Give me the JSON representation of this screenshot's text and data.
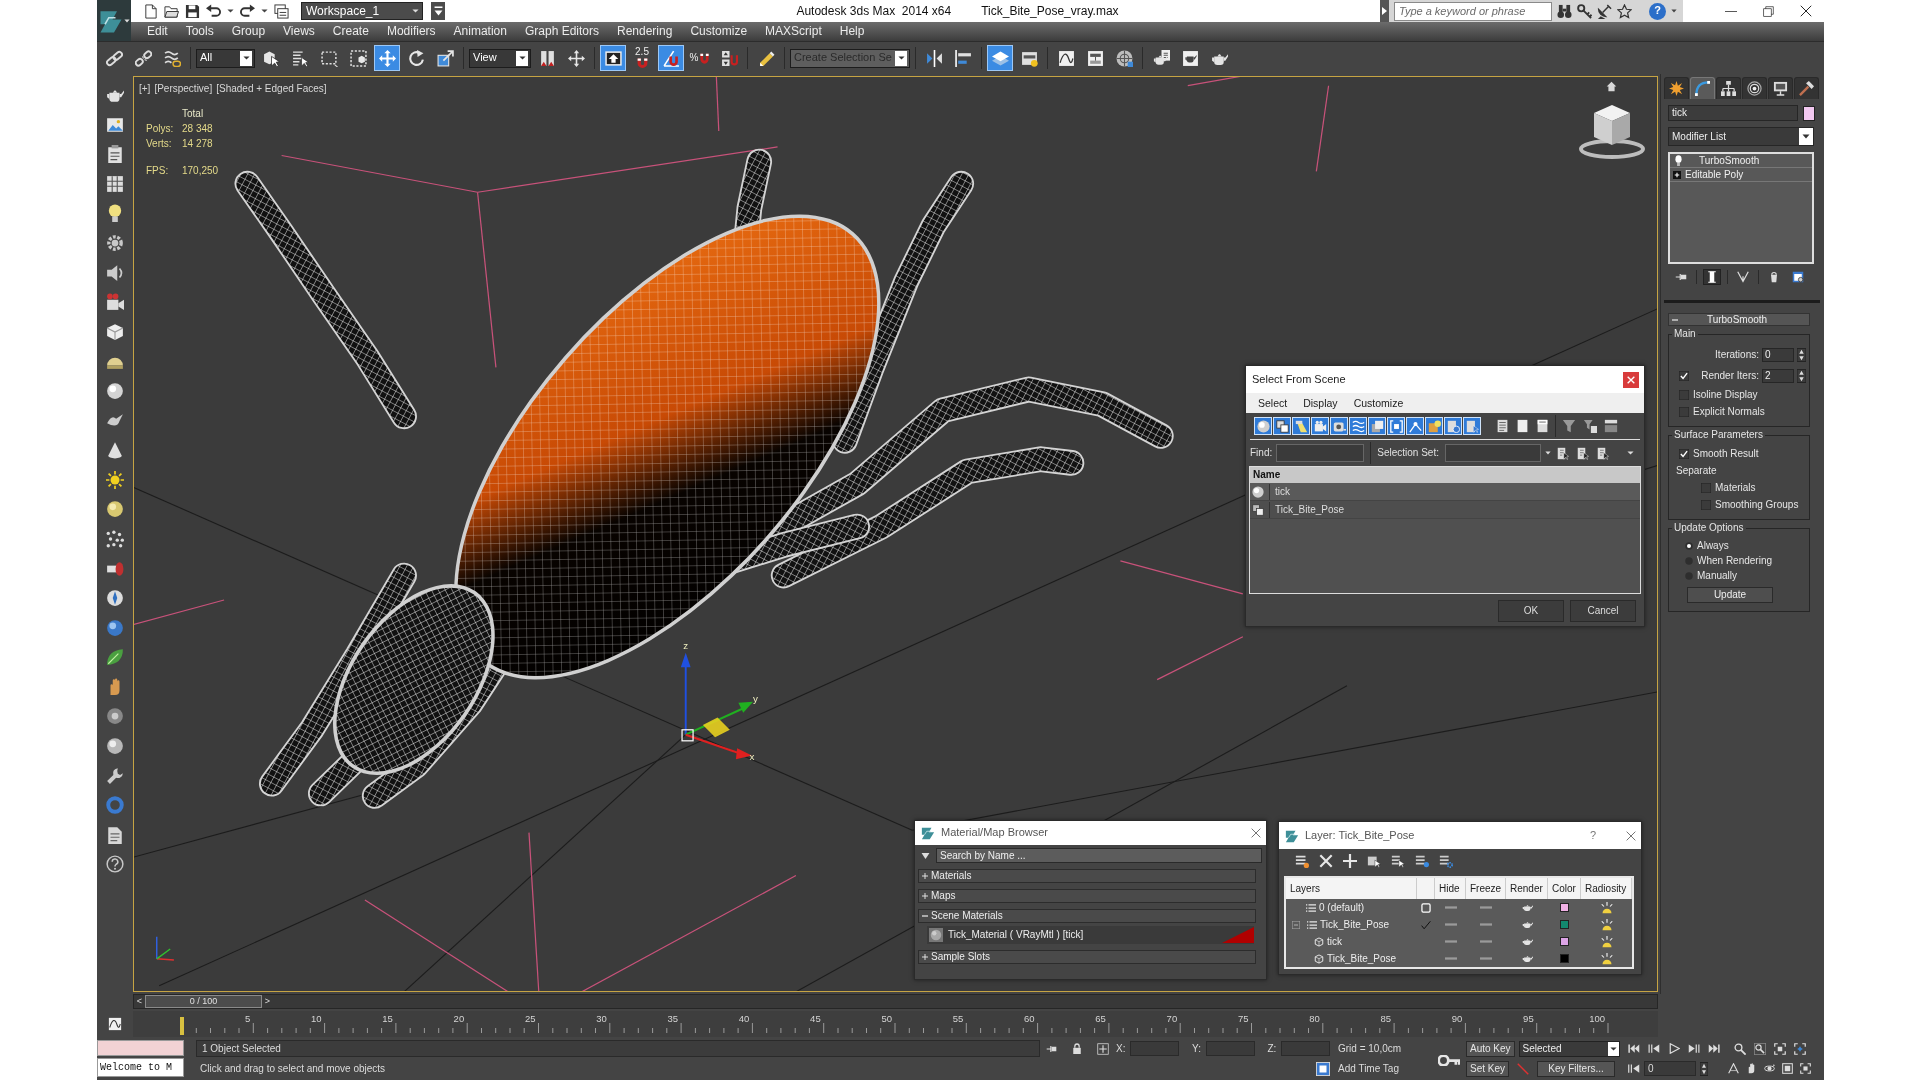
{
  "title_bar": {
    "workspace": "Workspace_1",
    "app": "Autodesk 3ds Max  2014 x64",
    "file": "Tick_Bite_Pose_vray.max",
    "search_placeholder": "Type a keyword or phrase",
    "help_label": "?"
  },
  "menu": [
    "Edit",
    "Tools",
    "Group",
    "Views",
    "Create",
    "Modifiers",
    "Animation",
    "Graph Editors",
    "Rendering",
    "Customize",
    "MAXScript",
    "Help"
  ],
  "main_toolbar": [
    {
      "kind": "tool",
      "selected": false
    },
    {
      "kind": "tool",
      "selected": false
    },
    {
      "kind": "tool",
      "selected": false
    },
    {
      "kind": "dropdown",
      "value": "All"
    },
    {
      "kind": "tool",
      "selected": false
    },
    {
      "kind": "tool",
      "selected": false
    },
    {
      "kind": "tool",
      "selected": false
    },
    {
      "kind": "tool",
      "selected": false
    },
    {
      "kind": "tool",
      "selected": true
    },
    {
      "kind": "tool",
      "selected": false
    },
    {
      "kind": "tool",
      "selected": false
    },
    {
      "kind": "dropdown",
      "value": "View"
    },
    {
      "kind": "tool",
      "selected": false
    },
    {
      "kind": "tool",
      "selected": false
    },
    {
      "kind": "tool",
      "selected": true
    },
    {
      "kind": "tool",
      "label": "2.5",
      "selected": false
    },
    {
      "kind": "tool",
      "selected": true
    },
    {
      "kind": "tool",
      "label": "%",
      "selected": false
    },
    {
      "kind": "tool",
      "selected": false
    },
    {
      "kind": "tool",
      "selected": false
    },
    {
      "kind": "dropdown",
      "placeholder": "Create Selection Se"
    },
    {
      "kind": "tool",
      "selected": false
    },
    {
      "kind": "tool",
      "selected": false
    },
    {
      "kind": "tool",
      "selected": true
    },
    {
      "kind": "tool",
      "selected": false
    },
    {
      "kind": "tool",
      "selected": false
    },
    {
      "kind": "tool",
      "selected": false
    },
    {
      "kind": "tool",
      "selected": false
    },
    {
      "kind": "tool",
      "selected": false
    },
    {
      "kind": "tool",
      "selected": false
    },
    {
      "kind": "tool",
      "selected": false
    }
  ],
  "viewport": {
    "labels": [
      "[+]",
      "[Perspective]",
      "[Shaded + Edged Faces]"
    ],
    "stats_title": "Total",
    "stats": [
      {
        "kind": "count",
        "label": "Polys:",
        "value": "28 348"
      },
      {
        "kind": "count",
        "label": "Verts:",
        "value": "14 278"
      },
      {
        "kind": "rate",
        "label": "FPS:",
        "value": "170,250"
      }
    ],
    "gizmo_labels": [
      "z",
      "y",
      "x"
    ]
  },
  "command_panel": {
    "tabs": [
      {
        "selected": false
      },
      {
        "selected": true
      },
      {
        "selected": false
      },
      {
        "selected": false
      },
      {
        "selected": false
      },
      {
        "selected": false
      }
    ],
    "object_name": "tick",
    "modifier_list": "Modifier List",
    "stack": [
      {
        "kind": "modifier",
        "name": "TurboSmooth",
        "enabled": true
      },
      {
        "kind": "object",
        "name": "Editable Poly",
        "expanded": false
      }
    ],
    "stack_buttons": [
      {
        "selected": false
      },
      {
        "selected": true
      },
      {
        "selected": false
      },
      {
        "selected": false
      },
      {
        "selected": false
      }
    ],
    "rollout": {
      "title": "TurboSmooth",
      "expanded": true,
      "groups": [
        {
          "title": "Main",
          "controls": [
            {
              "kind": "spinner",
              "label": "Iterations:",
              "value": "0"
            },
            {
              "kind": "spinner",
              "label": "Render Iters:",
              "value": "2",
              "checked": true
            },
            {
              "kind": "checkbox",
              "label": "Isoline Display",
              "checked": false
            },
            {
              "kind": "checkbox",
              "label": "Explicit Normals",
              "checked": false
            }
          ]
        },
        {
          "title": "Surface Parameters",
          "controls": [
            {
              "kind": "checkbox",
              "label": "Smooth Result",
              "checked": true
            },
            {
              "kind": "label",
              "label": "Separate",
              "children": [
                {
                  "kind": "checkbox",
                  "label": "Materials",
                  "checked": false
                },
                {
                  "kind": "checkbox",
                  "label": "Smoothing Groups",
                  "checked": false
                }
              ]
            }
          ]
        },
        {
          "title": "Update Options",
          "controls": [
            {
              "kind": "radio",
              "label": "Always",
              "selected": true
            },
            {
              "kind": "radio",
              "label": "When Rendering",
              "selected": false
            },
            {
              "kind": "radio",
              "label": "Manually",
              "selected": false
            },
            {
              "kind": "button",
              "label": "Update"
            }
          ]
        }
      ]
    }
  },
  "select_dialog": {
    "title": "Select From Scene",
    "menu": [
      "Select",
      "Display",
      "Customize"
    ],
    "filters": [
      {
        "selected": true
      },
      {
        "selected": true
      },
      {
        "selected": true
      },
      {
        "selected": true
      },
      {
        "selected": true
      },
      {
        "selected": true
      },
      {
        "selected": true
      },
      {
        "selected": true
      },
      {
        "selected": true
      },
      {
        "selected": true
      },
      {
        "selected": true
      },
      {
        "selected": true
      }
    ],
    "find_label": "Find:",
    "selection_set_label": "Selection Set:",
    "column": "Name",
    "rows": [
      {
        "kind": "geometry",
        "name": "tick",
        "selected": false
      },
      {
        "kind": "group",
        "name": "Tick_Bite_Pose",
        "selected": false
      }
    ],
    "buttons": [
      "OK",
      "Cancel"
    ]
  },
  "material_browser": {
    "title": "Material/Map Browser",
    "search_placeholder": "Search by Name ...",
    "groups": [
      {
        "title": "Materials",
        "expanded": false
      },
      {
        "title": "Maps",
        "expanded": false
      },
      {
        "title": "Scene Materials",
        "expanded": true,
        "items": [
          {
            "name": "Tick_Material ( VRayMtl ) [tick]"
          }
        ]
      },
      {
        "title": "Sample Slots",
        "expanded": false
      }
    ]
  },
  "layer_dialog": {
    "title": "Layer: Tick_Bite_Pose",
    "help_label": "?",
    "columns": [
      "Layers",
      "Hide",
      "Freeze",
      "Render",
      "Color",
      "Radiosity"
    ],
    "layers": [
      {
        "kind": "layer",
        "name": "0 (default)",
        "current": false,
        "hidden": false,
        "frozen": false,
        "color": "#f0b0e4"
      },
      {
        "kind": "layer",
        "name": "Tick_Bite_Pose",
        "current": true,
        "expanded": true,
        "hidden": false,
        "frozen": false,
        "color": "#12886e",
        "children": [
          {
            "kind": "object",
            "name": "tick",
            "hidden": false,
            "frozen": false,
            "color": "#dca4e6"
          },
          {
            "kind": "object",
            "name": "Tick_Bite_Pose",
            "hidden": false,
            "frozen": false,
            "color": "#000000"
          }
        ]
      }
    ]
  },
  "timeline": {
    "prev_label": "<",
    "thumb": "0 / 100",
    "next_label": ">"
  },
  "ruler": {
    "labels": [
      "5",
      "10",
      "15",
      "20",
      "25",
      "30",
      "35",
      "40",
      "45",
      "50",
      "55",
      "60",
      "65",
      "70",
      "75",
      "80",
      "85",
      "90",
      "95",
      "100"
    ]
  },
  "status_bar": {
    "listener_output": "Welcome to M",
    "selection_info": "1 Object Selected",
    "prompt": "Click and drag to select and move objects",
    "coord_labels": [
      "X:",
      "Y:",
      "Z:"
    ],
    "grid": "Grid = 10,0cm",
    "time_tag": "Add Time Tag",
    "auto_key": "Auto Key",
    "key_mode": "Selected",
    "set_key": "Set Key",
    "key_filters": "Key Filters...",
    "frame": "0"
  }
}
